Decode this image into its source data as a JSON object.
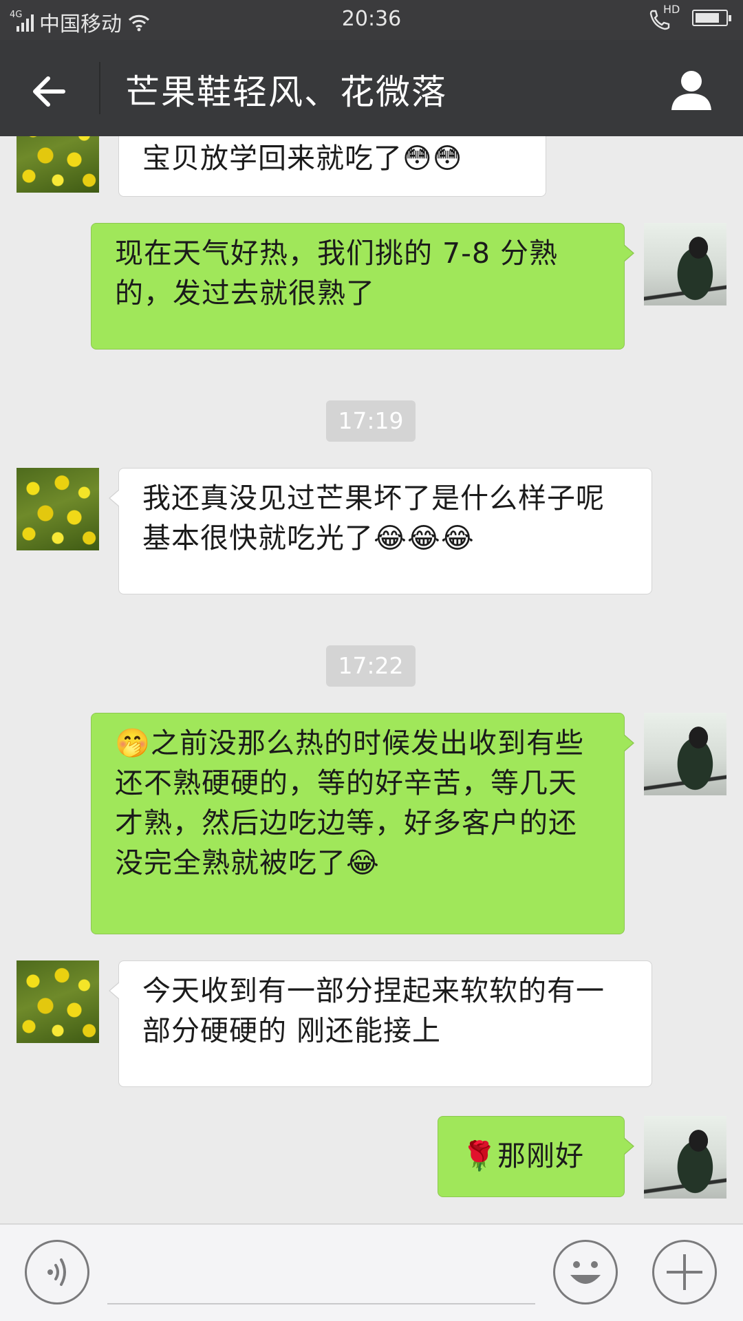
{
  "status_bar": {
    "network": "4G",
    "carrier": "中国移动",
    "time": "20:36",
    "call_badge": "HD",
    "battery_level": 0.82
  },
  "title_bar": {
    "title": "芒果鞋轻风、花微落",
    "back_icon": "arrow-left-icon",
    "profile_icon": "person-icon"
  },
  "messages": [
    {
      "type": "text",
      "from": "friend",
      "text": "宝贝放学回来就吃了😳😳"
    },
    {
      "type": "text",
      "from": "me",
      "text": "现在天气好热，我们挑的 7-8 分熟的，发过去就很熟了"
    },
    {
      "type": "time",
      "text": "17:19"
    },
    {
      "type": "text",
      "from": "friend",
      "text": "我还真没见过芒果坏了是什么样子呢  基本很快就吃光了😂😂😂"
    },
    {
      "type": "time",
      "text": "17:22"
    },
    {
      "type": "text",
      "from": "me",
      "text": "🤭之前没那么热的时候发出收到有些还不熟硬硬的，等的好辛苦，等几天才熟，然后边吃边等，好多客户的还没完全熟就被吃了😂"
    },
    {
      "type": "text",
      "from": "friend",
      "text": "今天收到有一部分捏起来软软的有一部分硬硬的  刚还能接上"
    },
    {
      "type": "text",
      "from": "me",
      "text": "🌹那刚好"
    }
  ],
  "input_bar": {
    "voice_icon": "voice-icon",
    "input_value": "",
    "emoji_icon": "emoji-icon",
    "plus_icon": "plus-icon"
  },
  "colors": {
    "title_bar": "#38393b",
    "status_bar": "#3b3b3d",
    "chat_background": "#ebebeb",
    "outgoing_bubble": "#a0e75a",
    "incoming_bubble": "#ffffff"
  }
}
